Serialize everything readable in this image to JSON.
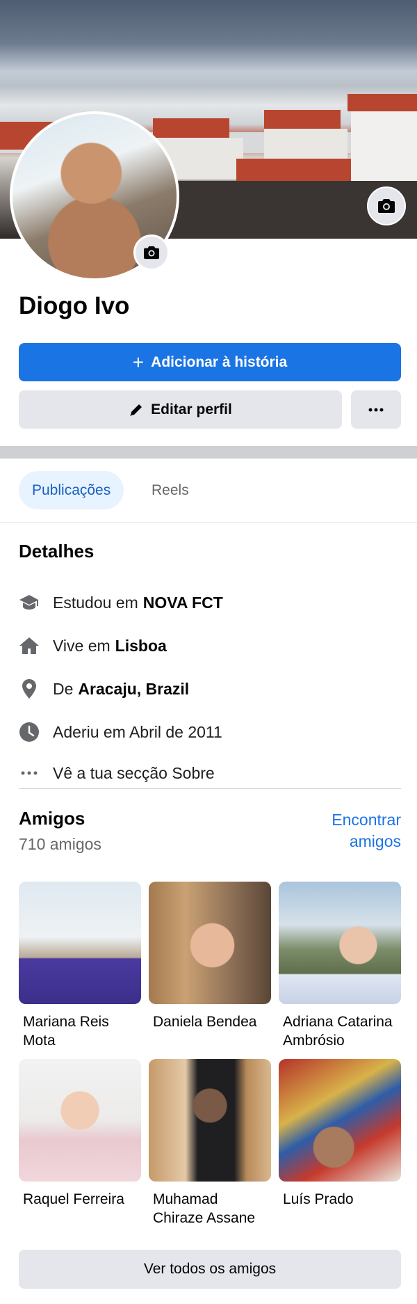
{
  "profile": {
    "name": "Diogo Ivo",
    "add_story_label": "Adicionar à história",
    "edit_profile_label": "Editar perfil"
  },
  "tabs": [
    {
      "label": "Publicações",
      "active": true
    },
    {
      "label": "Reels",
      "active": false
    }
  ],
  "details": {
    "title": "Detalhes",
    "items": [
      {
        "icon": "graduation-cap-icon",
        "prefix": "Estudou em",
        "value": "NOVA FCT"
      },
      {
        "icon": "home-icon",
        "prefix": "Vive em",
        "value": "Lisboa"
      },
      {
        "icon": "location-pin-icon",
        "prefix": "De",
        "value": "Aracaju, Brazil"
      },
      {
        "icon": "clock-icon",
        "prefix": "Aderiu em Abril de 2011",
        "value": ""
      },
      {
        "icon": "more-dots-icon",
        "prefix": "Vê a tua secção Sobre",
        "value": ""
      }
    ]
  },
  "friends": {
    "title": "Amigos",
    "count": "710 amigos",
    "find_label_1": "Encontrar",
    "find_label_2": "amigos",
    "list": [
      {
        "name": "Mariana Reis Mota"
      },
      {
        "name": "Daniela Bendea"
      },
      {
        "name": "Adriana Catarina Ambrósio"
      },
      {
        "name": "Raquel Ferreira"
      },
      {
        "name": "Muhamad Chiraze Assane"
      },
      {
        "name": "Luís Prado"
      }
    ],
    "see_all_label": "Ver todos os amigos"
  },
  "colors": {
    "primary": "#1b74e4",
    "secondary_button": "#e4e6eb",
    "active_tab_bg": "#e7f3ff",
    "muted_text": "#65676b"
  }
}
